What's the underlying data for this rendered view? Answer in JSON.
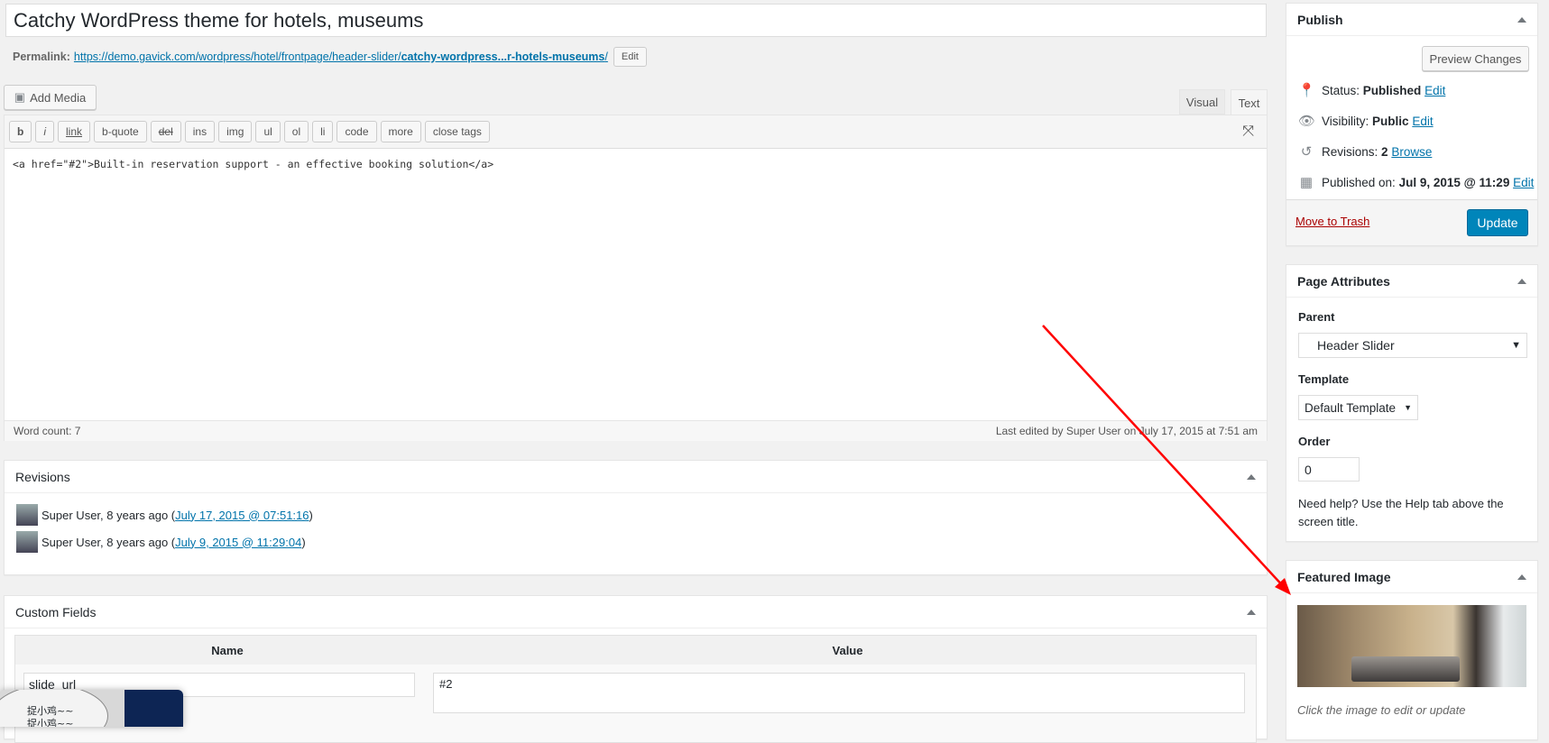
{
  "post": {
    "title": "Catchy WordPress theme for hotels, museums",
    "permalink_label": "Permalink:",
    "permalink_base": "https://demo.gavick.com/wordpress/hotel/frontpage/header-slider/",
    "permalink_slug": "catchy-wordpress...r-hotels-museums",
    "permalink_end": "/",
    "edit_label": "Edit"
  },
  "editor": {
    "add_media": "Add Media",
    "tabs": [
      "Visual",
      "Text"
    ],
    "quicktags": [
      "b",
      "i",
      "link",
      "b-quote",
      "del",
      "ins",
      "img",
      "ul",
      "ol",
      "li",
      "code",
      "more",
      "close tags"
    ],
    "content": "<a href=\"#2\">Built-in reservation support - an effective booking solution</a>",
    "word_count": "Word count: 7",
    "last_edited": "Last edited by Super User on July 17, 2015 at 7:51 am"
  },
  "revisions": {
    "title": "Revisions",
    "items": [
      {
        "text": "Super User, 8 years ago (",
        "link": "July 17, 2015 @ 07:51:16",
        "end": ")"
      },
      {
        "text": "Super User, 8 years ago (",
        "link": "July 9, 2015 @ 11:29:04",
        "end": ")"
      }
    ]
  },
  "custom_fields": {
    "title": "Custom Fields",
    "col_name": "Name",
    "col_value": "Value",
    "rows": [
      {
        "name": "slide_url",
        "value": "#2"
      }
    ]
  },
  "publish": {
    "title": "Publish",
    "preview": "Preview Changes",
    "status_label": "Status:",
    "status": "Published",
    "visibility_label": "Visibility:",
    "visibility": "Public",
    "revisions_label": "Revisions:",
    "revisions": "2",
    "browse": "Browse",
    "published_label": "Published on:",
    "published": "Jul 9, 2015 @ 11:29",
    "edit": "Edit",
    "trash": "Move to Trash",
    "update": "Update"
  },
  "page_attributes": {
    "title": "Page Attributes",
    "parent_label": "Parent",
    "parent_value": "Header Slider",
    "template_label": "Template",
    "template_value": "Default Template",
    "order_label": "Order",
    "order_value": "0",
    "help": "Need help? Use the Help tab above the screen title."
  },
  "featured_image": {
    "title": "Featured Image",
    "caption": "Click the image to edit or update"
  },
  "overlay": {
    "text1": "捉小鸡~~",
    "text2": "捉小鸡~~"
  },
  "colors": {
    "primary": "#0085ba",
    "link": "#0073aa",
    "trash": "#a00",
    "arrow": "#ff0000"
  }
}
